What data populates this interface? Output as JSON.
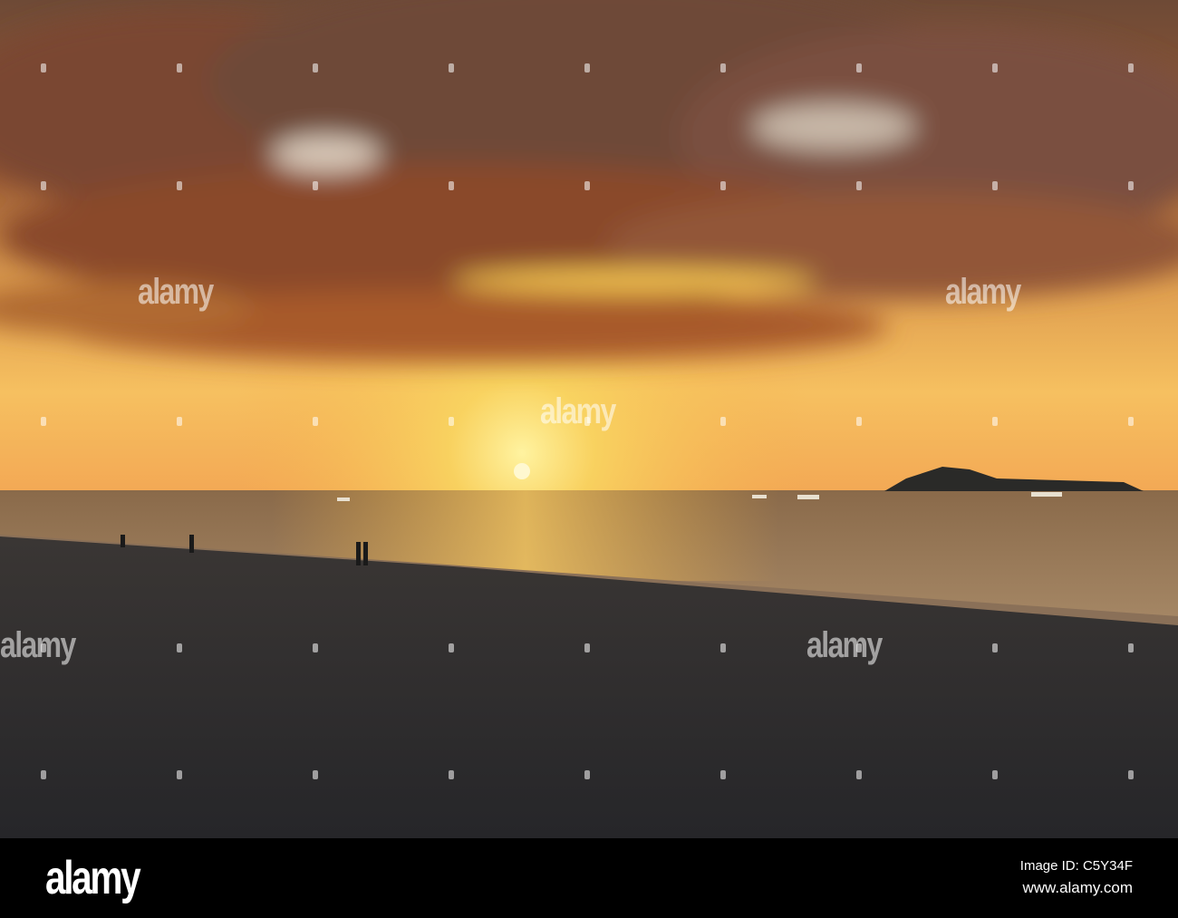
{
  "photo": {
    "watermark_text": "alamy",
    "colors": {
      "sky_top": "#7a4a2e",
      "sky_glow": "#f7c24a",
      "sun": "#fff6c8",
      "sea": "#b07a3a",
      "sand": "#2b2b2e"
    }
  },
  "footer": {
    "logo": "alamy",
    "image_id": "Image ID: C5Y34F",
    "website": "www.alamy.com"
  }
}
